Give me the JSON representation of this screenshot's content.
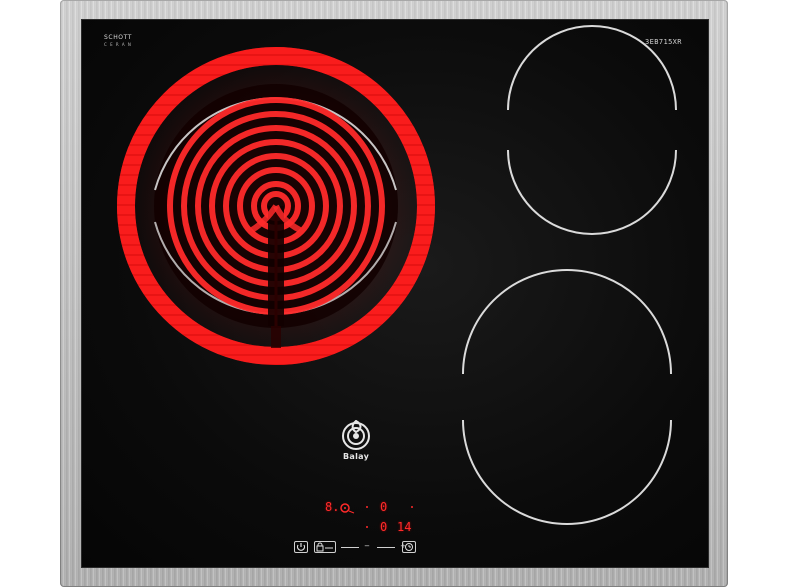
{
  "product": {
    "brand_top_left": "SCHOTT",
    "brand_top_left_sub": "C E R A N",
    "brand_top_left_tiny": "",
    "model_number": "3EB715XR",
    "logo_name": "Balay"
  },
  "cooktop": {
    "zones": [
      {
        "name": "front-left",
        "state": "heated"
      },
      {
        "name": "back-right",
        "state": "off"
      },
      {
        "name": "front-right",
        "state": "off"
      }
    ]
  },
  "display": {
    "left_digit": "8.",
    "left_zero": "0",
    "right_top_zero": "0",
    "right_bottom_zero": "0",
    "right_bottom_value": "14"
  },
  "controls": {
    "power_button_icon": "power-icon",
    "lock_button_icon": "lock-icon",
    "minus_symbol": "−",
    "plus_symbol": "+",
    "timer_button_icon": "timer-icon",
    "select_button_icon": "select-icon"
  },
  "colors": {
    "glass": "#0b0b0b",
    "heat": "#ff2a2a",
    "frame": "#b8b8b8",
    "ring": "#e6e6e6"
  }
}
